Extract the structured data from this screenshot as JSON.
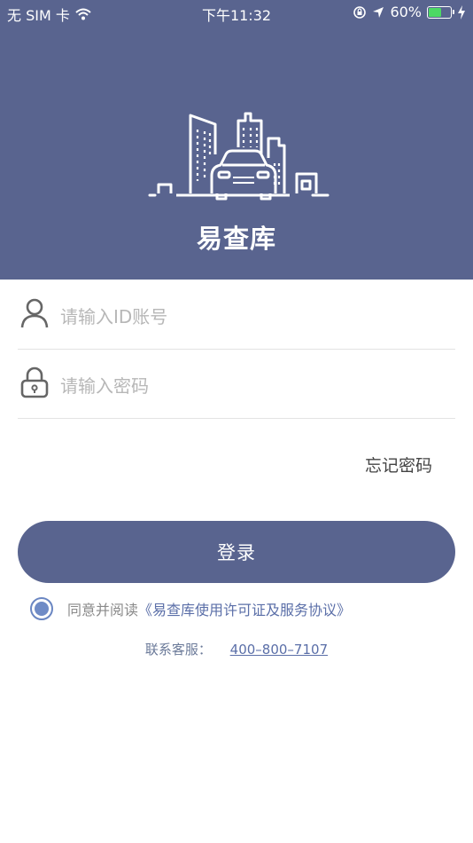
{
  "status_bar": {
    "carrier": "无 SIM 卡",
    "time": "下午11:32",
    "battery": "60%",
    "battery_level": 0.6
  },
  "app": {
    "name": "易查库"
  },
  "form": {
    "account_placeholder": "请输入ID账号",
    "password_placeholder": "请输入密码",
    "forgot_label": "忘记密码",
    "login_label": "登录"
  },
  "agreement": {
    "prefix": "同意并阅读",
    "link": "《易查库使用许可证及服务协议》",
    "checked": true
  },
  "contact": {
    "label": "联系客服：",
    "phone": "400–800–7107"
  },
  "colors": {
    "primary": "#59648F",
    "link": "#5b6fa8",
    "radio": "#6f8bc6"
  },
  "icons": [
    "wifi-icon",
    "location-lock-icon",
    "location-arrow-icon",
    "battery-icon",
    "charging-icon",
    "city-car-logo-icon",
    "user-icon",
    "lock-icon"
  ]
}
